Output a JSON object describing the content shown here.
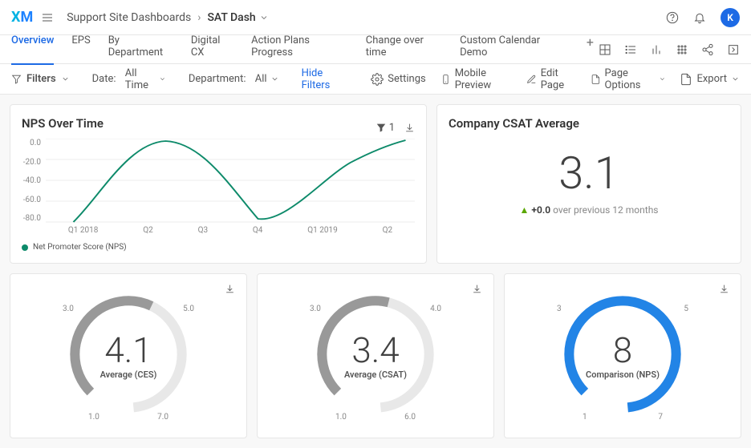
{
  "header": {
    "logo_x": "X",
    "logo_m": "M",
    "breadcrumb_parent": "Support Site Dashboards",
    "breadcrumb_current": "SAT Dash",
    "avatar_letter": "K"
  },
  "tabs": {
    "items": [
      "Overview",
      "EPS",
      "By Department",
      "Digital CX",
      "Action Plans Progress",
      "Change over time",
      "Custom Calendar Demo"
    ],
    "active": 0
  },
  "filters": {
    "label": "Filters",
    "date_label": "Date:",
    "date_value": "All Time",
    "dept_label": "Department:",
    "dept_value": "All",
    "hide": "Hide Filters"
  },
  "toolbar": {
    "settings": "Settings",
    "mobile": "Mobile Preview",
    "edit": "Edit Page",
    "page_options": "Page Options",
    "export": "Export"
  },
  "nps_card": {
    "title": "NPS Over Time",
    "filter_count": "1",
    "legend": "Net Promoter Score (NPS)"
  },
  "csat_card": {
    "title": "Company CSAT Average",
    "value": "3.1",
    "delta": "+0.0",
    "delta_text": " over previous 12 months"
  },
  "gauge1": {
    "value": "4.1",
    "label": "Average (CES)",
    "tl": "3.0",
    "tr": "5.0",
    "bl": "1.0",
    "br": "7.0"
  },
  "gauge2": {
    "value": "3.4",
    "label": "Average (CSAT)",
    "tl": "3.0",
    "tr": "4.0",
    "bl": "1.0",
    "br": "6.0"
  },
  "gauge3": {
    "value": "8",
    "label": "Comparison (NPS)",
    "tl": "3",
    "tr": "5",
    "bl": "1",
    "br": "7"
  },
  "chart_data": {
    "type": "line",
    "title": "NPS Over Time",
    "series": [
      {
        "name": "Net Promoter Score (NPS)",
        "values": [
          -80,
          -30,
          2,
          -30,
          -80,
          -30,
          2
        ]
      }
    ],
    "categories": [
      "Q1 2018",
      "Q2",
      "Q3",
      "Q4",
      "Q1 2019",
      "Q2",
      ""
    ],
    "ylabel": "",
    "xlabel": "",
    "ylim": [
      -80,
      0
    ],
    "y_ticks": [
      "0.0",
      "-20.0",
      "-40.0",
      "-60.0",
      "-80.0"
    ]
  }
}
